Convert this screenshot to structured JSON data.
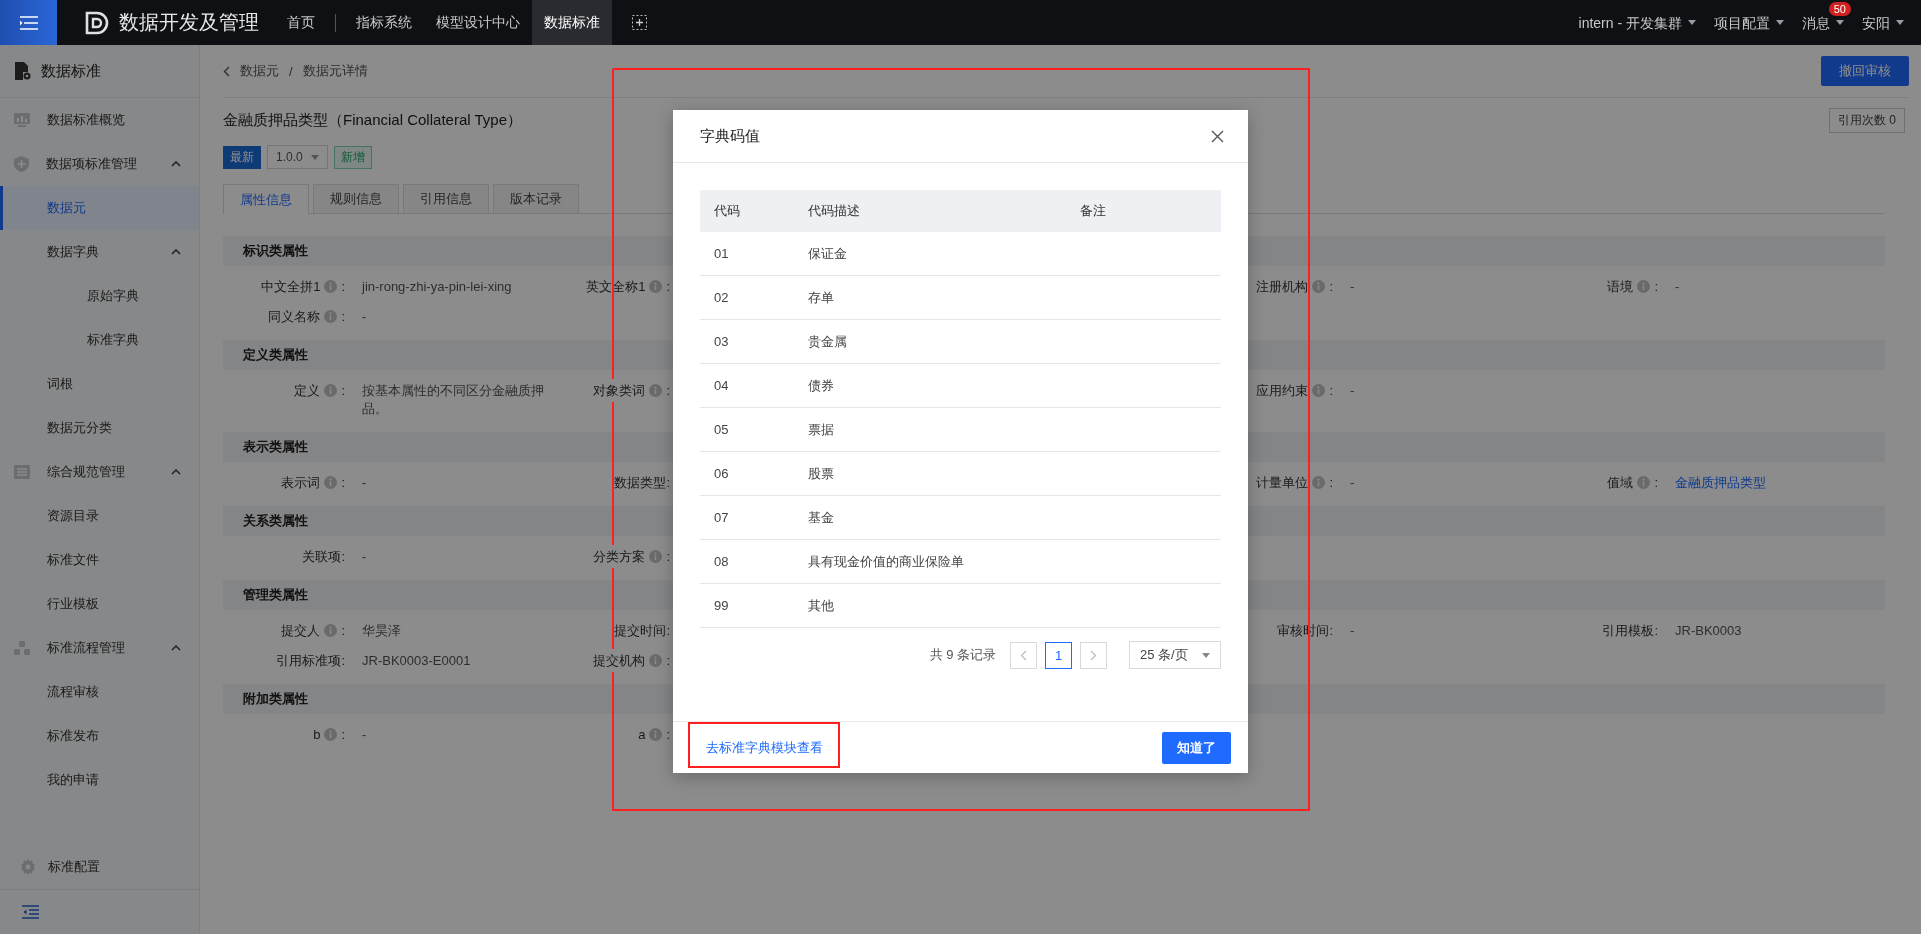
{
  "topbar": {
    "brand": "数据开发及管理",
    "nav": [
      {
        "label": "首页",
        "selected": false
      },
      {
        "label": "指标系统",
        "selected": false
      },
      {
        "label": "模型设计中心",
        "selected": false
      },
      {
        "label": "数据标准",
        "selected": true
      }
    ],
    "right_menus": [
      {
        "label": "intern - 开发集群"
      },
      {
        "label": "项目配置"
      },
      {
        "label": "消息",
        "badge": "50"
      },
      {
        "label": "安阳"
      }
    ]
  },
  "sidebar": {
    "title": "数据标准",
    "items": [
      {
        "label": "数据标准概览",
        "selected": false
      },
      {
        "label": "数据项标准管理",
        "selected": false,
        "expanded": true,
        "children": [
          {
            "label": "数据元",
            "selected": true
          },
          {
            "label": "数据字典",
            "selected": false,
            "expanded": true,
            "children": [
              {
                "label": "原始字典",
                "selected": false
              },
              {
                "label": "标准字典",
                "selected": false
              }
            ]
          },
          {
            "label": "词根",
            "selected": false
          },
          {
            "label": "数据元分类",
            "selected": false
          }
        ]
      },
      {
        "label": "综合规范管理",
        "selected": false,
        "expanded": true,
        "children": [
          {
            "label": "资源目录",
            "selected": false
          },
          {
            "label": "标准文件",
            "selected": false
          },
          {
            "label": "行业模板",
            "selected": false
          }
        ]
      },
      {
        "label": "标准流程管理",
        "selected": false,
        "expanded": true,
        "children": [
          {
            "label": "流程审核",
            "selected": false
          },
          {
            "label": "标准发布",
            "selected": false
          },
          {
            "label": "我的申请",
            "selected": false
          }
        ]
      }
    ],
    "footer": "标准配置"
  },
  "detail": {
    "breadcrumb": {
      "items": [
        "数据元",
        "数据元详情"
      ],
      "separator": "/"
    },
    "action_button": "撤回审核",
    "title": "金融质押品类型（Financial Collateral Type）",
    "ref_count": "引用次数 0",
    "version_badge": "最新",
    "version": "1.0.0",
    "status_tag": "新增",
    "tabs": [
      {
        "label": "属性信息",
        "selected": true
      },
      {
        "label": "规则信息",
        "selected": false
      },
      {
        "label": "引用信息",
        "selected": false
      },
      {
        "label": "版本记录",
        "selected": false
      }
    ],
    "sections": [
      {
        "title": "标识类属性",
        "fields": [
          {
            "label": "中文全拼1",
            "info": true,
            "colon": ":",
            "value": "jin-rong-zhi-ya-pin-lei-xing"
          },
          {
            "label": "英文全称1",
            "info": true,
            "colon": ":"
          },
          {
            "label": "注册机构",
            "info": true,
            "colon": ":",
            "value": "-"
          },
          {
            "label": "语境",
            "info": true,
            "colon": ":",
            "value": "-"
          },
          {
            "label": "同义名称",
            "info": true,
            "colon": ":",
            "value": "-"
          }
        ]
      },
      {
        "title": "定义类属性",
        "fields": [
          {
            "label": "定义",
            "info": true,
            "colon": ":",
            "value": "按基本属性的不同区分金融质押品。"
          },
          {
            "label": "对象类词",
            "info": true,
            "colon": ":"
          },
          {
            "label": "应用约束",
            "info": true,
            "colon": ":",
            "value": "-"
          }
        ]
      },
      {
        "title": "表示类属性",
        "fields": [
          {
            "label": "表示词",
            "info": true,
            "colon": ":",
            "value": "-"
          },
          {
            "label": "数据类型:",
            "info": false
          },
          {
            "label": "计量单位",
            "info": true,
            "colon": ":",
            "value": "-"
          },
          {
            "label": "值域",
            "info": true,
            "colon": ":",
            "value": "金融质押品类型",
            "link": true
          }
        ]
      },
      {
        "title": "关系类属性",
        "fields": [
          {
            "label": "关联项:",
            "info": false,
            "value": "-"
          },
          {
            "label": "分类方案",
            "info": true,
            "colon": ":"
          }
        ]
      },
      {
        "title": "管理类属性",
        "fields": [
          {
            "label": "提交人",
            "info": true,
            "colon": ":",
            "value": "华昊泽"
          },
          {
            "label": "提交时间:",
            "info": false
          },
          {
            "label": "审核时间:",
            "info": false,
            "value": "-"
          },
          {
            "label": "引用模板:",
            "info": false,
            "value": "JR-BK0003"
          },
          {
            "label": "引用标准项:",
            "info": false,
            "value": "JR-BK0003-E0001"
          },
          {
            "label": "提交机构",
            "info": true,
            "colon": ":"
          }
        ]
      },
      {
        "title": "附加类属性",
        "fields": [
          {
            "label": "b",
            "info": true,
            "colon": ":",
            "value": "-"
          },
          {
            "label": "a",
            "info": true,
            "colon": ":"
          }
        ]
      }
    ]
  },
  "modal": {
    "title": "字典码值",
    "columns": [
      "代码",
      "代码描述",
      "备注"
    ],
    "rows": [
      {
        "code": "01",
        "description": "保证金"
      },
      {
        "code": "02",
        "description": "存单"
      },
      {
        "code": "03",
        "description": "贵金属"
      },
      {
        "code": "04",
        "description": "债券"
      },
      {
        "code": "05",
        "description": "票据"
      },
      {
        "code": "06",
        "description": "股票"
      },
      {
        "code": "07",
        "description": "基金"
      },
      {
        "code": "08",
        "description": "具有现金价值的商业保险单"
      },
      {
        "code": "99",
        "description": "其他"
      }
    ],
    "total": "共 9 条记录",
    "prev_disabled": true,
    "next_disabled": true,
    "pages": [
      {
        "label": "1",
        "selected": true
      }
    ],
    "page_size": "25 条/页",
    "link": "去标准字典模块查看",
    "confirm": "知道了"
  }
}
